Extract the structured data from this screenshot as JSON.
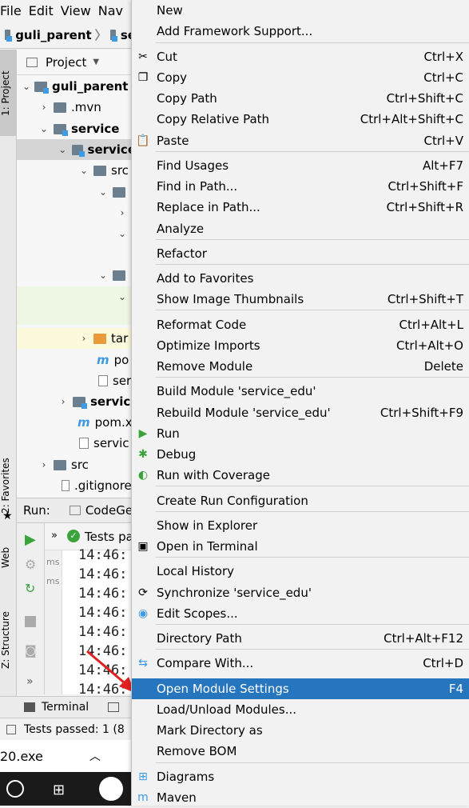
{
  "menubar": [
    "File",
    "Edit",
    "View",
    "Nav"
  ],
  "breadcrumb": {
    "root": "guli_parent",
    "child": "se"
  },
  "project": {
    "header": "Project",
    "tree": [
      {
        "label": "guli_parent",
        "bold": true
      },
      {
        "label": ".mvn"
      },
      {
        "label": "service",
        "bold": true
      },
      {
        "label": "service",
        "bold": true
      },
      {
        "label": "src"
      },
      {
        "label": ""
      },
      {
        "label": ""
      },
      {
        "label": ""
      },
      {
        "label": ""
      },
      {
        "label": ""
      },
      {
        "label": "tar"
      },
      {
        "label": "po"
      },
      {
        "label": "ser"
      },
      {
        "label": "servic",
        "bold": true
      },
      {
        "label": "pom.x"
      },
      {
        "label": "servic"
      },
      {
        "label": "src"
      },
      {
        "label": ".gitignore"
      }
    ]
  },
  "sidetabs": {
    "project": "1: Project",
    "favorites": "2: Favorites",
    "web": "Web",
    "structure": "Z: Structure"
  },
  "run": {
    "label": "Run:",
    "tab": "CodeGe",
    "tests": "Tests pa",
    "ms1": "ms",
    "ms2": "ms"
  },
  "console": [
    "14:46:",
    "14:46:",
    "14:46:",
    "14:46:",
    "14:46:",
    "14:46:",
    "14:46:",
    "14:46:"
  ],
  "bottom": {
    "terminal": "Terminal",
    "status": "Tests passed: 1 (8",
    "exe": "20.exe"
  },
  "menu": {
    "items": [
      {
        "label": "New",
        "shortcut": "",
        "submenu": true
      },
      {
        "label": "Add Framework Support...",
        "shortcut": ""
      },
      {
        "label": "Cut",
        "shortcut": "Ctrl+X",
        "icon": "scissors-icon"
      },
      {
        "label": "Copy",
        "shortcut": "Ctrl+C",
        "icon": "copy-icon"
      },
      {
        "label": "Copy Path",
        "shortcut": "Ctrl+Shift+C"
      },
      {
        "label": "Copy Relative Path",
        "shortcut": "Ctrl+Alt+Shift+C"
      },
      {
        "label": "Paste",
        "shortcut": "Ctrl+V",
        "icon": "paste-icon"
      },
      {
        "label": "Find Usages",
        "shortcut": "Alt+F7"
      },
      {
        "label": "Find in Path...",
        "shortcut": "Ctrl+Shift+F"
      },
      {
        "label": "Replace in Path...",
        "shortcut": "Ctrl+Shift+R"
      },
      {
        "label": "Analyze",
        "shortcut": "",
        "submenu": true
      },
      {
        "label": "Refactor",
        "shortcut": "",
        "submenu": true
      },
      {
        "label": "Add to Favorites",
        "shortcut": "",
        "submenu": true
      },
      {
        "label": "Show Image Thumbnails",
        "shortcut": "Ctrl+Shift+T"
      },
      {
        "label": "Reformat Code",
        "shortcut": "Ctrl+Alt+L"
      },
      {
        "label": "Optimize Imports",
        "shortcut": "Ctrl+Alt+O"
      },
      {
        "label": "Remove Module",
        "shortcut": "Delete"
      },
      {
        "label": "Build Module 'service_edu'",
        "shortcut": ""
      },
      {
        "label": "Rebuild Module 'service_edu'",
        "shortcut": "Ctrl+Shift+F9"
      },
      {
        "label": "Run",
        "shortcut": "",
        "submenu": true,
        "icon": "run-icon"
      },
      {
        "label": "Debug",
        "shortcut": "",
        "submenu": true,
        "icon": "debug-icon"
      },
      {
        "label": "Run with Coverage",
        "shortcut": "",
        "submenu": true,
        "icon": "coverage-icon"
      },
      {
        "label": "Create Run Configuration",
        "shortcut": "",
        "submenu": true
      },
      {
        "label": "Show in Explorer",
        "shortcut": ""
      },
      {
        "label": "Open in Terminal",
        "shortcut": "",
        "icon": "terminal-icon"
      },
      {
        "label": "Local History",
        "shortcut": "",
        "submenu": true
      },
      {
        "label": "Synchronize 'service_edu'",
        "shortcut": "",
        "icon": "sync-icon"
      },
      {
        "label": "Edit Scopes...",
        "shortcut": "",
        "icon": "scope-icon"
      },
      {
        "label": "Directory Path",
        "shortcut": "Ctrl+Alt+F12"
      },
      {
        "label": "Compare With...",
        "shortcut": "Ctrl+D",
        "icon": "compare-icon"
      },
      {
        "label": "Open Module Settings",
        "shortcut": "F4",
        "selected": true
      },
      {
        "label": "Load/Unload Modules...",
        "shortcut": ""
      },
      {
        "label": "Mark Directory as",
        "shortcut": "",
        "submenu": true
      },
      {
        "label": "Remove BOM",
        "shortcut": ""
      },
      {
        "label": "Diagrams",
        "shortcut": "",
        "submenu": true,
        "icon": "diagram-icon"
      },
      {
        "label": "Maven",
        "shortcut": "",
        "submenu": true,
        "icon": "maven-icon"
      }
    ]
  },
  "colors": {
    "selection": "#2675bf",
    "run_green": "#3aa33a",
    "annotation_arrow": "#e02020"
  }
}
